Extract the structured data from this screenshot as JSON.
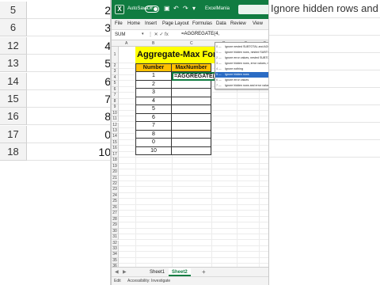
{
  "background_left": {
    "rows": [
      {
        "header": "5",
        "value": "2"
      },
      {
        "header": "6",
        "value": "3"
      },
      {
        "header": "12",
        "value": "4"
      },
      {
        "header": "13",
        "value": "5"
      },
      {
        "header": "14",
        "value": "6"
      },
      {
        "header": "15",
        "value": "7"
      },
      {
        "header": "16",
        "value": "8"
      },
      {
        "header": "17",
        "value": "0"
      },
      {
        "header": "18",
        "value": "10"
      }
    ]
  },
  "background_right": {
    "hint": "Ignore hidden rows and error"
  },
  "titlebar": {
    "logo": "X",
    "autosave_label": "AutoSave",
    "toggle_label": "Off",
    "file_name": "ExcelMania"
  },
  "menu": [
    "File",
    "Home",
    "Insert",
    "Page Layout",
    "Formulas",
    "Data",
    "Review",
    "View"
  ],
  "formula_bar": {
    "name_box": "SUM",
    "icons": "⋮  ✕  ✓  fx",
    "formula": "=AGGREGATE(4,"
  },
  "columns": [
    "A",
    "B",
    "C",
    "D",
    "E",
    "F"
  ],
  "row_numbers": [
    "1",
    "2",
    "3",
    "4",
    "5",
    "6",
    "7",
    "8",
    "9",
    "10",
    "11",
    "12",
    "13",
    "14",
    "15",
    "16",
    "17",
    "18",
    "19",
    "20",
    "21",
    "22",
    "23",
    "24",
    "25",
    "26",
    "27",
    "28",
    "29",
    "30",
    "31",
    "32",
    "33",
    "34",
    "35",
    "36"
  ],
  "sheet": {
    "title": "Aggregate-Max Formula",
    "header_number": "Number",
    "header_max": "MaxNumber",
    "numbers": [
      "1",
      "2",
      "3",
      "4",
      "5",
      "6",
      "7",
      "8",
      "0",
      "10"
    ],
    "edit_cell": "=AGGREGATE(4,"
  },
  "autocomplete": {
    "items": [
      {
        "num": "0 —",
        "text": "Ignore nested SUBTOTAL and AGGREGATE functions"
      },
      {
        "num": "1 —",
        "text": "Ignore hidden rows, nested SUBTOTAL and AGGREGATE"
      },
      {
        "num": "2 —",
        "text": "Ignore error values, nested SUBTOTAL and AGGREGATE"
      },
      {
        "num": "3 —",
        "text": "Ignore hidden rows, error values, nested"
      },
      {
        "num": "4 —",
        "text": "Ignore nothing"
      },
      {
        "num": "5 —",
        "text": "Ignore hidden rows"
      },
      {
        "num": "6 —",
        "text": "Ignore error values"
      },
      {
        "num": "7 —",
        "text": "Ignore hidden rows and error values"
      }
    ],
    "selected_index": 5
  },
  "tabs": {
    "sheet1": "Sheet1",
    "sheet2": "Sheet2",
    "add": "+"
  },
  "status": {
    "mode": "Edit",
    "accessibility": "Accessibility: Investigate"
  },
  "colors": {
    "excel_green": "#107c41",
    "title_fill": "#ffff00",
    "header_fill": "#ffc000",
    "selection_blue": "#2b6cc4"
  }
}
